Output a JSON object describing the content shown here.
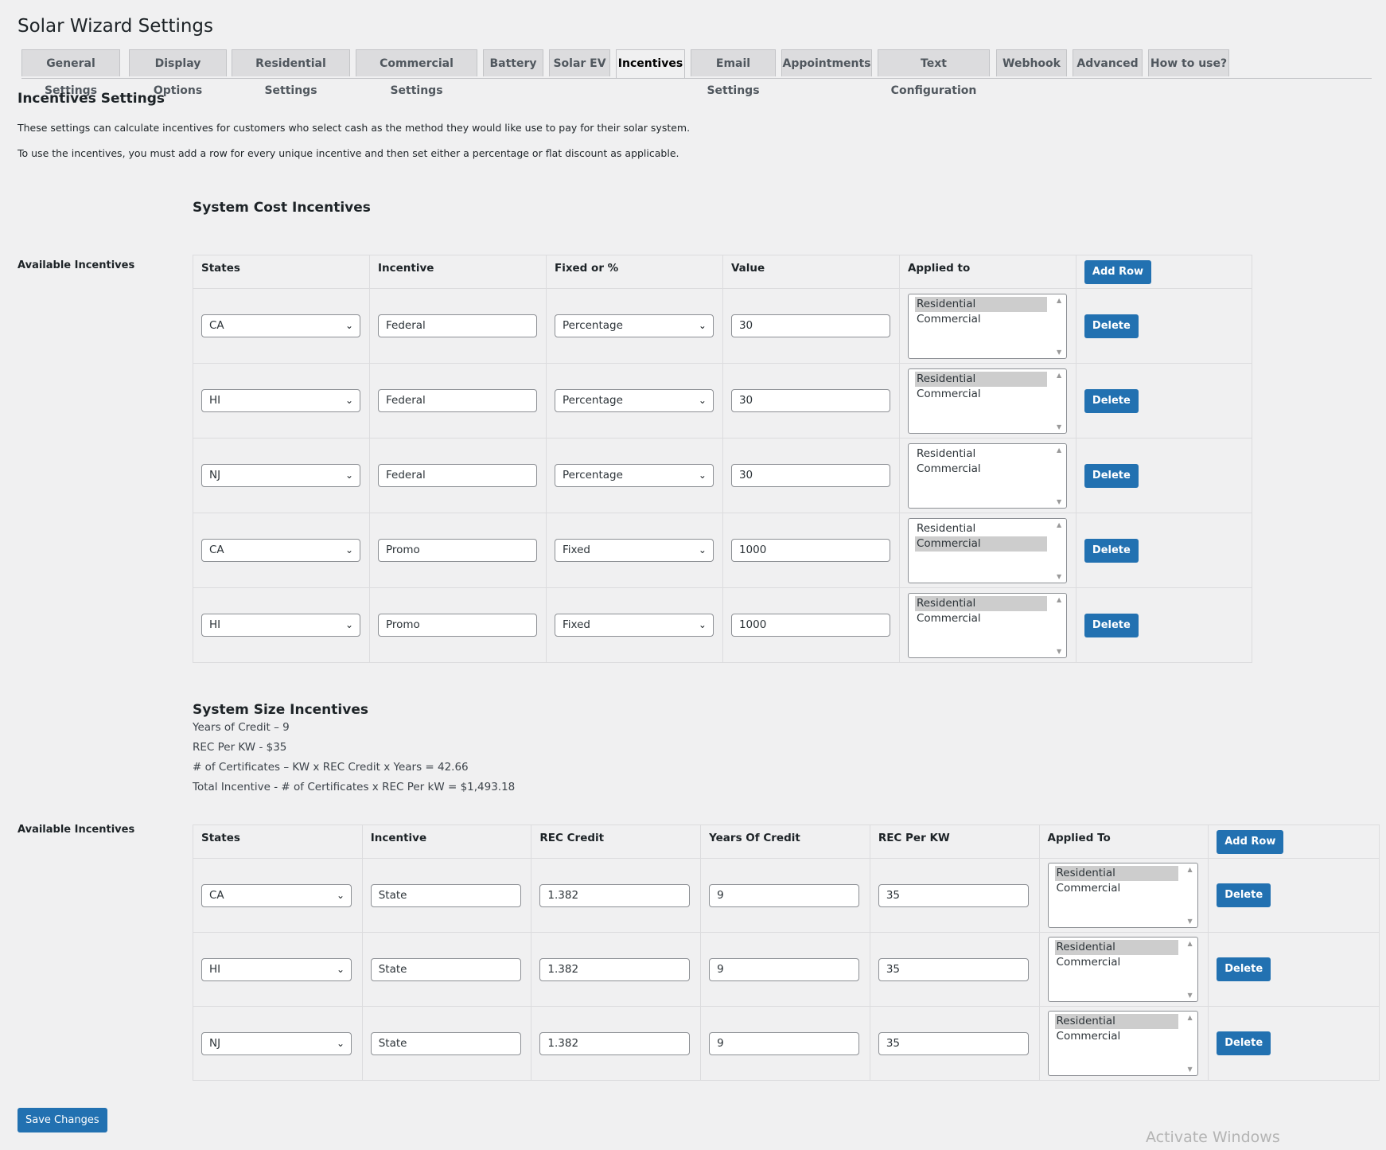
{
  "page_title": "Solar Wizard Settings",
  "tabs": [
    {
      "label": "General Settings"
    },
    {
      "label": "Display Options"
    },
    {
      "label": "Residential Settings"
    },
    {
      "label": "Commercial Settings"
    },
    {
      "label": "Battery"
    },
    {
      "label": "Solar EV"
    },
    {
      "label": "Incentives",
      "active": true
    },
    {
      "label": "Email Settings"
    },
    {
      "label": "Appointments"
    },
    {
      "label": "Text Configuration"
    },
    {
      "label": "Webhook"
    },
    {
      "label": "Advanced"
    },
    {
      "label": "How to use?"
    }
  ],
  "section_title": "Incentives Settings",
  "description": [
    "These settings can calculate incentives for customers who select cash as the method they would like use to pay for their solar system.",
    "To use the incentives, you must add a row for every unique incentive and then set either a percentage or flat discount as applicable."
  ],
  "cost": {
    "title": "System Cost Incentives",
    "row_label": "Available Incentives",
    "headers": [
      "States",
      "Incentive",
      "Fixed or %",
      "Value",
      "Applied to"
    ],
    "add_row_label": "Add Row",
    "delete_label": "Delete",
    "applied_options": [
      "Residential",
      "Commercial"
    ],
    "rows": [
      {
        "state": "CA",
        "incentive": "Federal",
        "type": "Percentage",
        "value": "30",
        "applied": "Residential"
      },
      {
        "state": "HI",
        "incentive": "Federal",
        "type": "Percentage",
        "value": "30",
        "applied": "Residential"
      },
      {
        "state": "NJ",
        "incentive": "Federal",
        "type": "Percentage",
        "value": "30",
        "applied": ""
      },
      {
        "state": "CA",
        "incentive": "Promo",
        "type": "Fixed",
        "value": "1000",
        "applied": "Commercial"
      },
      {
        "state": "HI",
        "incentive": "Promo",
        "type": "Fixed",
        "value": "1000",
        "applied": "Residential"
      }
    ]
  },
  "size": {
    "title": "System Size Incentives",
    "info": [
      "Years of Credit – 9",
      "REC Per KW - $35",
      "# of Certificates – KW x REC Credit x Years = 42.66",
      "Total Incentive - # of Certificates x REC Per kW = $1,493.18"
    ],
    "row_label": "Available Incentives",
    "headers": [
      "States",
      "Incentive",
      "REC Credit",
      "Years Of Credit",
      "REC Per KW",
      "Applied To"
    ],
    "add_row_label": "Add Row",
    "delete_label": "Delete",
    "applied_options": [
      "Residential",
      "Commercial"
    ],
    "rows": [
      {
        "state": "CA",
        "incentive": "State",
        "rec_credit": "1.382",
        "years": "9",
        "rec_per_kw": "35",
        "applied": "Residential"
      },
      {
        "state": "HI",
        "incentive": "State",
        "rec_credit": "1.382",
        "years": "9",
        "rec_per_kw": "35",
        "applied": "Residential"
      },
      {
        "state": "NJ",
        "incentive": "State",
        "rec_credit": "1.382",
        "years": "9",
        "rec_per_kw": "35",
        "applied": "Residential"
      }
    ]
  },
  "save_label": "Save Changes",
  "watermark": "Activate Windows"
}
